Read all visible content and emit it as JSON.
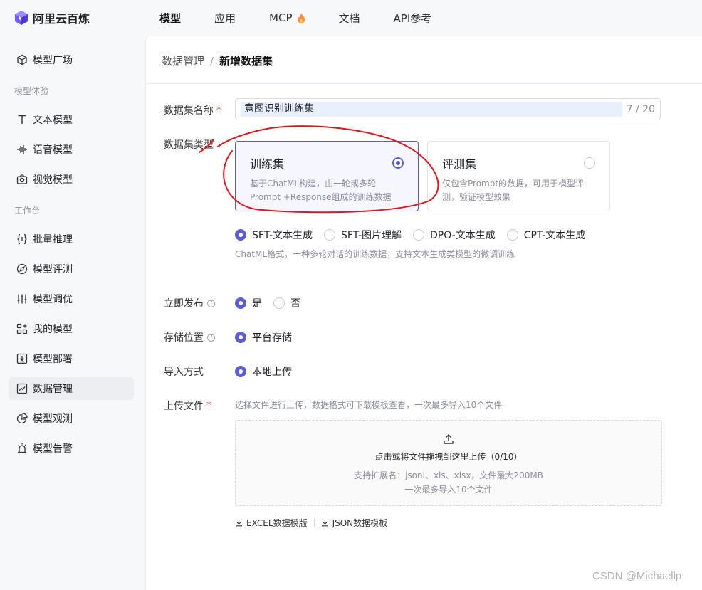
{
  "app": {
    "title": "阿里云百炼"
  },
  "nav": {
    "items": [
      "模型",
      "应用",
      "MCP",
      "文档",
      "API参考"
    ]
  },
  "sidebar": {
    "items": [
      {
        "label": "模型广场",
        "icon": "model-plaza-icon"
      },
      {
        "group": "模型体验"
      },
      {
        "label": "文本模型",
        "icon": "text-icon"
      },
      {
        "label": "语音模型",
        "icon": "audio-wave-icon"
      },
      {
        "label": "视觉模型",
        "icon": "camera-icon"
      },
      {
        "group": "工作台"
      },
      {
        "label": "批量推理",
        "icon": "braces-icon"
      },
      {
        "label": "模型评测",
        "icon": "compass-icon"
      },
      {
        "label": "模型调优",
        "icon": "sliders-icon"
      },
      {
        "label": "我的模型",
        "icon": "grid-plus-icon"
      },
      {
        "label": "模型部署",
        "icon": "deploy-icon"
      },
      {
        "label": "数据管理",
        "icon": "chart-line-icon",
        "active": true
      },
      {
        "label": "模型观测",
        "icon": "pie-chart-icon"
      },
      {
        "label": "模型告警",
        "icon": "alarm-icon"
      }
    ]
  },
  "breadcrumb": {
    "parent": "数据管理",
    "sep": "/",
    "current": "新增数据集"
  },
  "form": {
    "name": {
      "label": "数据集名称",
      "required": "*",
      "value": "意图识别训练集",
      "count": "7 / 20"
    },
    "type": {
      "label": "数据集类型",
      "cards": [
        {
          "title": "训练集",
          "desc": "基于ChatML构建，由一轮或多轮Prompt +Response组成的训练数据",
          "selected": true
        },
        {
          "title": "评测集",
          "desc": "仅包含Prompt的数据，可用于模型评测，验证模型效果",
          "selected": false
        }
      ],
      "formats": [
        "SFT-文本生成",
        "SFT-图片理解",
        "DPO-文本生成",
        "CPT-文本生成"
      ],
      "format_selected": 0,
      "format_hint": "ChatML格式，一种多轮对话的训练数据，支持文本生成类模型的微调训练"
    },
    "publish": {
      "label": "立即发布",
      "help": "?",
      "options": [
        "是",
        "否"
      ],
      "selected": 0
    },
    "storage": {
      "label": "存储位置",
      "help": "?",
      "options": [
        "平台存储"
      ],
      "selected": 0
    },
    "import": {
      "label": "导入方式",
      "options": [
        "本地上传"
      ],
      "selected": 0
    },
    "upload": {
      "label": "上传文件",
      "required": "*",
      "hint": "选择文件进行上传，数据格式可下载模板查看，一次最多导入10个文件",
      "main": "点击或将文件拖拽到这里上传（0/10）",
      "sub1": "支持扩展名：jsonl、xls、xlsx，文件最大200MB",
      "sub2": "一次最多导入10个文件",
      "templates": [
        "EXCEL数据模版",
        "JSON数据模板"
      ]
    }
  },
  "watermark": "CSDN @Michaellp",
  "colors": {
    "accent": "#5b5bd6",
    "annotation": "#e0161b",
    "required": "#e94e4e"
  }
}
